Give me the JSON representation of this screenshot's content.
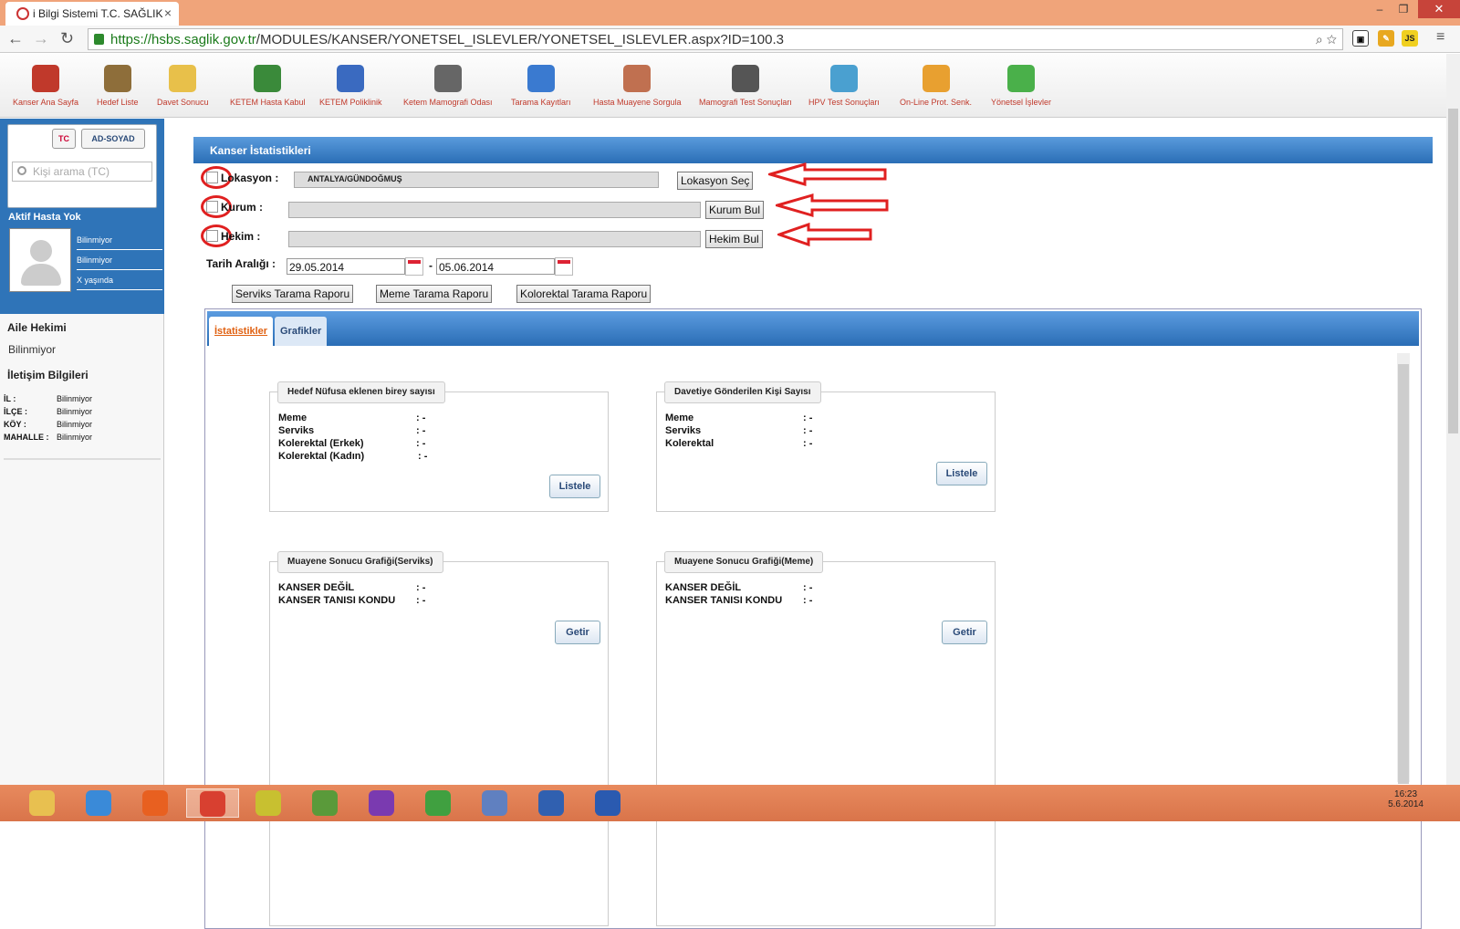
{
  "browser": {
    "tab_title": "i Bilgi Sistemi T.C. SAĞLIK",
    "url_host": "https://hsbs.saglik.gov.tr",
    "url_path": "/MODULES/KANSER/YONETSEL_ISLEVLER/YONETSEL_ISLEVLER.aspx?ID=100.3",
    "ext_label": "JS"
  },
  "toolbar": {
    "items": [
      {
        "label": "Kanser Ana Sayfa",
        "icon": "home-icon",
        "color": "#c0392b"
      },
      {
        "label": "Hedef Liste",
        "icon": "clipboard-icon",
        "color": "#8e6e3a"
      },
      {
        "label": "Davet Sonucu",
        "icon": "envelope-icon",
        "color": "#e8c04a"
      },
      {
        "label": "KETEM Hasta Kabul",
        "icon": "add-user-icon",
        "color": "#3a8a3a"
      },
      {
        "label": "KETEM Poliklinik",
        "icon": "stethoscope-icon",
        "color": "#3a6ac0"
      },
      {
        "label": "Ketem Mamografi Odası",
        "icon": "presentation-icon",
        "color": "#666666"
      },
      {
        "label": "Tarama Kayıtları",
        "icon": "form-icon",
        "color": "#3a7ad0"
      },
      {
        "label": "Hasta Muayene Sorgula",
        "icon": "doctor-search-icon",
        "color": "#c07050"
      },
      {
        "label": "Mamografi Test Sonuçları",
        "icon": "xray-icon",
        "color": "#555555"
      },
      {
        "label": "HPV Test Sonuçları",
        "icon": "flask-icon",
        "color": "#4aa0d0"
      },
      {
        "label": "On-Line Prot. Senk.",
        "icon": "sync-arrows-icon",
        "color": "#e8a030"
      },
      {
        "label": "Yönetsel İşlevler",
        "icon": "pie-chart-icon",
        "color": "#4ab04a"
      }
    ]
  },
  "sidebar": {
    "tab_tc": "TC",
    "tab_adsoyad": "AD-SOYAD",
    "search_placeholder": "Kişi arama (TC)",
    "aktif_hasta": "Aktif Hasta Yok",
    "info": [
      "Bilinmiyor",
      "Bilinmiyor",
      "X yaşında"
    ],
    "aile_hekimi_title": "Aile Hekimi",
    "aile_hekimi_value": "Bilinmiyor",
    "iletisim_title": "İletişim Bilgileri",
    "contact": [
      {
        "key": "İL :",
        "value": "Bilinmiyor"
      },
      {
        "key": "İLÇE :",
        "value": "Bilinmiyor"
      },
      {
        "key": "KÖY :",
        "value": "Bilinmiyor"
      },
      {
        "key": "MAHALLE :",
        "value": "Bilinmiyor"
      }
    ]
  },
  "main": {
    "header": "Kanser İstatistikleri",
    "lokasyon_label": "Lokasyon :",
    "lokasyon_value": "ANTALYA/GÜNDOĞMUŞ",
    "lokasyon_button": "Lokasyon Seç",
    "kurum_label": "Kurum :",
    "kurum_value": "",
    "kurum_button": "Kurum Bul",
    "hekim_label": "Hekim :",
    "hekim_value": "",
    "hekim_button": "Hekim Bul",
    "tarih_label": "Tarih Aralığı :",
    "date_from": "29.05.2014",
    "date_sep": "-",
    "date_to": "05.06.2014",
    "report_buttons": [
      "Serviks Tarama Raporu",
      "Meme Tarama Raporu",
      "Kolorektal Tarama Raporu"
    ],
    "tabs": [
      "İstatistikler",
      "Grafikler"
    ]
  },
  "panels": {
    "hedef": {
      "title": "Hedef Nüfusa eklenen birey sayısı",
      "rows": [
        {
          "label": "Meme",
          "value": ": -"
        },
        {
          "label": "Serviks",
          "value": ": -"
        },
        {
          "label": "Kolerektal (Erkek)",
          "value": ": -"
        },
        {
          "label": "Kolerektal (Kadın)",
          "value": ": -"
        }
      ],
      "button": "Listele"
    },
    "davetiye": {
      "title": "Davetiye Gönderilen Kişi Sayısı",
      "rows": [
        {
          "label": "Meme",
          "value": ": -"
        },
        {
          "label": "Serviks",
          "value": ": -"
        },
        {
          "label": "Kolerektal",
          "value": ": -"
        }
      ],
      "button": "Listele"
    },
    "serviks": {
      "title": "Muayene Sonucu Grafiği(Serviks)",
      "rows": [
        {
          "label": "KANSER DEĞİL",
          "value": ": -"
        },
        {
          "label": "KANSER TANISI KONDU",
          "value": ": -"
        }
      ],
      "button": "Getir"
    },
    "meme": {
      "title": "Muayene Sonucu Grafiği(Meme)",
      "rows": [
        {
          "label": "KANSER DEĞİL",
          "value": ": -"
        },
        {
          "label": "KANSER TANISI KONDU",
          "value": ": -"
        }
      ],
      "button": "Getir"
    }
  },
  "taskbar": {
    "apps": [
      {
        "icon": "folder-icon",
        "color": "#e8c050"
      },
      {
        "icon": "internet-explorer-icon",
        "color": "#3a8ad8"
      },
      {
        "icon": "firefox-icon",
        "color": "#e86020"
      },
      {
        "icon": "chrome-icon",
        "color": "#d84030"
      },
      {
        "icon": "snipping-tool-icon",
        "color": "#c8c030"
      },
      {
        "icon": "frog-icon",
        "color": "#5a9a3a"
      },
      {
        "icon": "visual-studio-icon",
        "color": "#7a3ab0"
      },
      {
        "icon": "chart-app-icon",
        "color": "#40a040"
      },
      {
        "icon": "paint-icon",
        "color": "#6080c0"
      },
      {
        "icon": "remote-desktop-icon",
        "color": "#3060b0"
      },
      {
        "icon": "word-icon",
        "color": "#2a5ab0"
      }
    ],
    "time": "16:23",
    "date": "5.6.2014"
  }
}
